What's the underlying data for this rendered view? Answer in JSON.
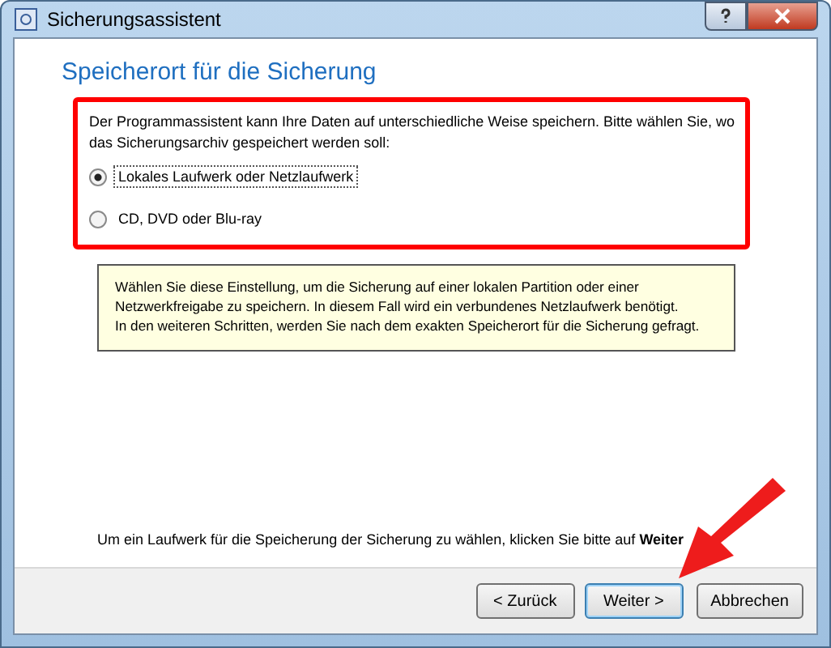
{
  "window": {
    "title": "Sicherungsassistent"
  },
  "heading": "Speicherort für die Sicherung",
  "intro": "Der Programmassistent kann Ihre Daten auf unterschiedliche Weise speichern. Bitte wählen Sie, wo das Sicherungsarchiv gespeichert werden soll:",
  "options": [
    {
      "label": "Lokales Laufwerk oder Netzlaufwerk",
      "selected": true
    },
    {
      "label": "CD, DVD oder Blu-ray",
      "selected": false
    }
  ],
  "note": [
    "Wählen Sie diese Einstellung, um die Sicherung auf einer lokalen Partition oder einer",
    "Netzwerkfreigabe zu speichern. In diesem Fall wird ein verbundenes Netzlaufwerk benötigt.",
    "In den weiteren Schritten, werden Sie nach dem exakten Speicherort für die Sicherung gefragt."
  ],
  "hint": "Um ein Laufwerk für die Speicherung der Sicherung zu wählen, klicken Sie bitte auf **Weiter**",
  "buttons": [
    {
      "label": "< Zurück",
      "default": false
    },
    {
      "label": "Weiter >",
      "default": true
    },
    {
      "label": "Abbrechen",
      "default": false
    }
  ]
}
